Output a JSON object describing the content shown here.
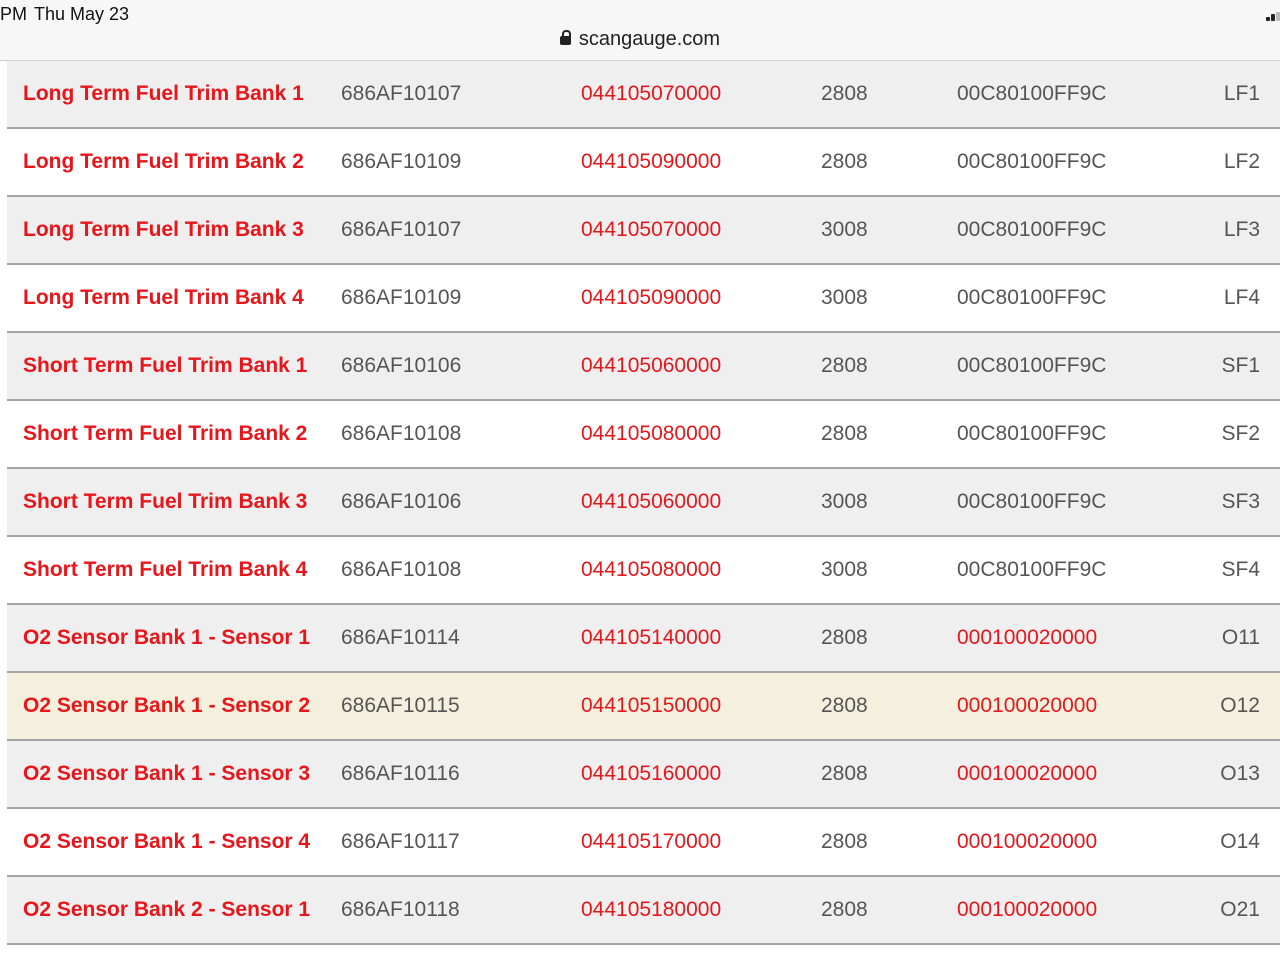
{
  "status_bar": {
    "time": "PM",
    "date": "Thu May 23"
  },
  "address_bar": {
    "url": "scangauge.com"
  },
  "table": {
    "rows": [
      {
        "name": "Long Term Fuel Trim Bank 1",
        "txd": "686AF10107",
        "rxf": "044105070000",
        "rxd": "2808",
        "mth": "00C80100FF9C",
        "code": "LF1"
      },
      {
        "name": "Long Term Fuel Trim Bank 2",
        "txd": "686AF10109",
        "rxf": "044105090000",
        "rxd": "2808",
        "mth": "00C80100FF9C",
        "code": "LF2"
      },
      {
        "name": "Long Term Fuel Trim Bank 3",
        "txd": "686AF10107",
        "rxf": "044105070000",
        "rxd": "3008",
        "mth": "00C80100FF9C",
        "code": "LF3"
      },
      {
        "name": "Long Term Fuel Trim Bank 4",
        "txd": "686AF10109",
        "rxf": "044105090000",
        "rxd": "3008",
        "mth": "00C80100FF9C",
        "code": "LF4"
      },
      {
        "name": "Short Term Fuel Trim Bank 1",
        "txd": "686AF10106",
        "rxf": "044105060000",
        "rxd": "2808",
        "mth": "00C80100FF9C",
        "code": "SF1"
      },
      {
        "name": "Short Term Fuel Trim Bank 2",
        "txd": "686AF10108",
        "rxf": "044105080000",
        "rxd": "2808",
        "mth": "00C80100FF9C",
        "code": "SF2"
      },
      {
        "name": "Short Term Fuel Trim Bank 3",
        "txd": "686AF10106",
        "rxf": "044105060000",
        "rxd": "3008",
        "mth": "00C80100FF9C",
        "code": "SF3"
      },
      {
        "name": "Short Term Fuel Trim Bank 4",
        "txd": "686AF10108",
        "rxf": "044105080000",
        "rxd": "3008",
        "mth": "00C80100FF9C",
        "code": "SF4"
      },
      {
        "name": "O2 Sensor Bank 1 - Sensor 1",
        "txd": "686AF10114",
        "rxf": "044105140000",
        "rxd": "2808",
        "mth": "000100020000",
        "code": "O11"
      },
      {
        "name": "O2 Sensor Bank 1 - Sensor 2",
        "txd": "686AF10115",
        "rxf": "044105150000",
        "rxd": "2808",
        "mth": "000100020000",
        "code": "O12"
      },
      {
        "name": "O2 Sensor Bank 1 - Sensor 3",
        "txd": "686AF10116",
        "rxf": "044105160000",
        "rxd": "2808",
        "mth": "000100020000",
        "code": "O13"
      },
      {
        "name": "O2 Sensor Bank 1 - Sensor 4",
        "txd": "686AF10117",
        "rxf": "044105170000",
        "rxd": "2808",
        "mth": "000100020000",
        "code": "O14"
      },
      {
        "name": "O2 Sensor Bank 2 - Sensor 1",
        "txd": "686AF10118",
        "rxf": "044105180000",
        "rxd": "2808",
        "mth": "000100020000",
        "code": "O21"
      }
    ]
  },
  "colors": {
    "accent_red": "#e8161b",
    "text_gray": "#555555",
    "row_alt_bg": "#efefef",
    "row_highlight_bg": "#f5f0de"
  }
}
